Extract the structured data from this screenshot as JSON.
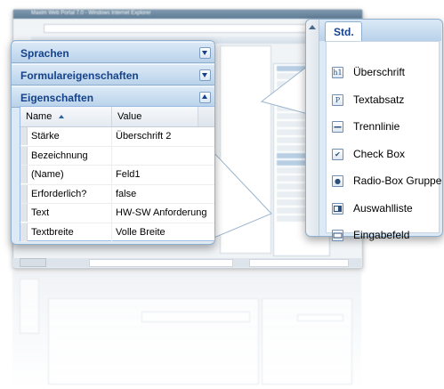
{
  "background_window": {
    "title": "Maxim Web Portal 7.0 - Windows Internet Explorer"
  },
  "left_panel": {
    "sections": [
      {
        "label": "Sprachen",
        "state": "collapsed"
      },
      {
        "label": "Formulareigenschaften",
        "state": "collapsed"
      },
      {
        "label": "Eigenschaften",
        "state": "expanded"
      }
    ],
    "grid": {
      "columns": [
        "Name",
        "Value"
      ],
      "sort": "ascending",
      "rows": [
        {
          "name": "Stärke",
          "value": "Überschrift 2"
        },
        {
          "name": "Bezeichnung",
          "value": ""
        },
        {
          "name": "(Name)",
          "value": "Feld1"
        },
        {
          "name": "Erforderlich?",
          "value": "false"
        },
        {
          "name": "Text",
          "value": "HW-SW Anforderung"
        },
        {
          "name": "Textbreite",
          "value": "Volle Breite"
        }
      ]
    }
  },
  "right_panel": {
    "tab": "Std.",
    "tools": [
      {
        "label": "Überschrift",
        "icon": "heading-icon",
        "glyph": "h1"
      },
      {
        "label": "Textabsatz",
        "icon": "paragraph-icon",
        "glyph": "P"
      },
      {
        "label": "Trennlinie",
        "icon": "divider-icon",
        "glyph": ""
      },
      {
        "label": "Check Box",
        "icon": "checkbox-icon",
        "glyph": "✔"
      },
      {
        "label": "Radio-Box Gruppe",
        "icon": "radio-icon",
        "glyph": "●"
      },
      {
        "label": "Auswahlliste",
        "icon": "listbox-icon",
        "glyph": ""
      },
      {
        "label": "Eingabefeld",
        "icon": "textfield-icon",
        "glyph": ""
      }
    ]
  },
  "colors": {
    "header_text": "#15428b",
    "panel_border": "#8fb0cf",
    "panel_bg": "#dde9f4"
  }
}
